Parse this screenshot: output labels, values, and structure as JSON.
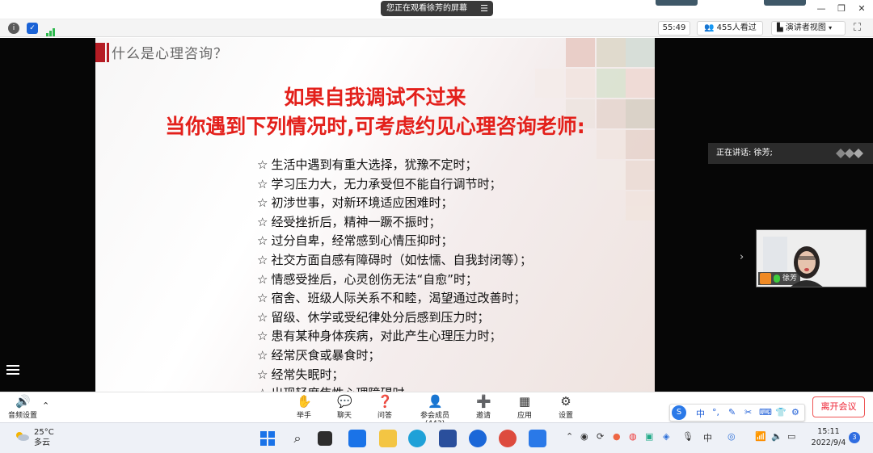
{
  "titlebar": {
    "share_label": "您正在观看徐芳的屏幕",
    "menu_icon": "menu-icon"
  },
  "toolbar": {
    "timer": "55:49",
    "viewers": "455人看过",
    "view_mode": "演讲者视图"
  },
  "slide": {
    "subtitle": "什么是心理咨询？",
    "heading_line1": "如果自我调试不过来",
    "heading_line2": "当你遇到下列情况时,可考虑约见心理咨询老师:",
    "star": "☆",
    "items": [
      "生活中遇到有重大选择，犹豫不定时；",
      "学习压力大，无力承受但不能自行调节时；",
      "初涉世事，对新环境适应困难时；",
      "经受挫折后，精神一蹶不振时；",
      "过分自卑，经常感到心情压抑时；",
      "社交方面自感有障碍时（如怯懦、自我封闭等）；",
      "情感受挫后，心灵创伤无法“自愈”时；",
      "宿舍、班级人际关系不和睦，渴望通过改善时；",
      "留级、休学或受纪律处分后感到压力时；",
      "患有某种身体疾病，对此产生心理压力时；",
      "经常厌食或暴食时；",
      "经常失眠时；",
      "出现轻度焦性心理障碍时"
    ]
  },
  "side": {
    "speaking": "正在讲话: 徐芳;",
    "speaker_name": "徐芳"
  },
  "controls": {
    "audio": "音频设置",
    "raise_hand": "举手",
    "chat": "聊天",
    "qa": "问答",
    "participants": "参会成员(443)",
    "invite": "邀请",
    "apps": "应用",
    "settings": "设置",
    "leave": "离开会议"
  },
  "ime": {
    "mode": "中"
  },
  "taskbar": {
    "temperature": "25°C",
    "weather": "多云",
    "time": "15:11",
    "date": "2022/9/4",
    "tray_lang": "中",
    "notifications": "3"
  },
  "colors": {
    "heading": "#e3201b",
    "accent_bar": "#b51c24",
    "leave_button": "#e22233"
  }
}
